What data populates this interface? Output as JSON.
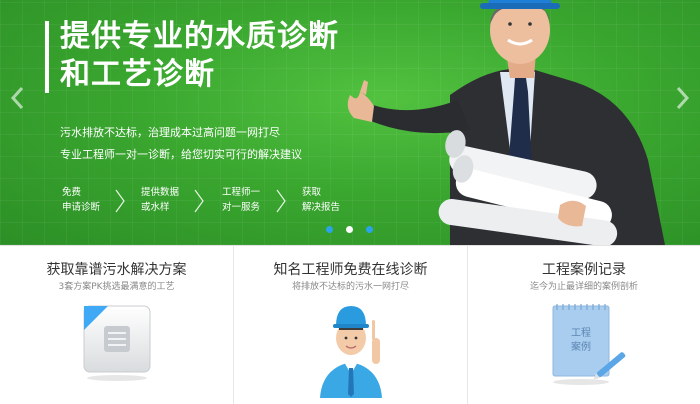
{
  "hero": {
    "title_line1": "提供专业的水质诊断",
    "title_line2": "和工艺诊断",
    "sub_line1": "污水排放不达标，治理成本过高问题一网打尽",
    "sub_line2": "专业工程师一对一诊断，给您切实可行的解决建议",
    "steps": [
      {
        "line1": "免费",
        "line2": "申请诊断"
      },
      {
        "line1": "提供数据",
        "line2": "或水样"
      },
      {
        "line1": "工程师一",
        "line2": "对一服务"
      },
      {
        "line1": "获取",
        "line2": "解决报告"
      }
    ],
    "carousel": {
      "slide_count": 3,
      "active_index": 0
    },
    "colors": {
      "green": "#3aa72f",
      "dot_active": "#2aa3e8",
      "dot_inactive": "#ffffff"
    }
  },
  "cards": [
    {
      "title": "获取靠谱污水解决方案",
      "desc": "3套方案PK挑选最满意的工艺",
      "icon": "document-icon"
    },
    {
      "title": "知名工程师免费在线诊断",
      "desc": "将排放不达标的污水一网打尽",
      "icon": "engineer-icon"
    },
    {
      "title": "工程案例记录",
      "desc": "迄今为止最详细的案例剖析",
      "icon": "notebook-icon",
      "notebook_line1": "工程",
      "notebook_line2": "案例"
    }
  ]
}
